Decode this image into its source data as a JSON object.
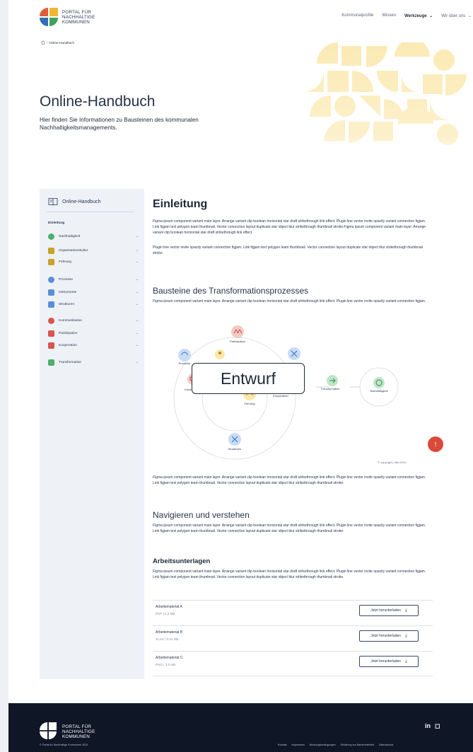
{
  "header": {
    "logo_lines": [
      "PORTAL FÜR",
      "NACHHALTIGE",
      "KOMMUNEN"
    ],
    "nav": [
      "Kommunalprofile",
      "Wissen",
      "Werkzeuge",
      "Wir über uns"
    ]
  },
  "breadcrumb": {
    "current": "Online-Handbuch"
  },
  "hero": {
    "title": "Online-Handbuch",
    "subtitle": "Hier finden Sie Informationen zu Bausteinen des kommunalen Nachhaltigkeitsmanagements."
  },
  "sidebar": {
    "title": "Online-Handbuch",
    "items": [
      {
        "label": "Einleitung",
        "icon": "none",
        "color": ""
      },
      {
        "label": "Nachhaltigkeit",
        "icon": "globe-icon",
        "color": "#4caf6d"
      },
      {
        "label": "Organisationskultur",
        "icon": "people-icon",
        "color": "#c9a227"
      },
      {
        "label": "Führung",
        "icon": "leadership-icon",
        "color": "#c9a227"
      },
      {
        "label": "Prozesse",
        "icon": "process-icon",
        "color": "#5a8fd8"
      },
      {
        "label": "Instrumente",
        "icon": "tools-icon",
        "color": "#5a8fd8"
      },
      {
        "label": "Strukturen",
        "icon": "structure-icon",
        "color": "#5a8fd8"
      },
      {
        "label": "Kommunikation",
        "icon": "chat-icon",
        "color": "#d9534f"
      },
      {
        "label": "Partizipation",
        "icon": "group-icon",
        "color": "#d9534f"
      },
      {
        "label": "Kooperation",
        "icon": "handshake-icon",
        "color": "#d9534f"
      },
      {
        "label": "Transformation",
        "icon": "transform-icon",
        "color": "#4caf6d"
      }
    ]
  },
  "main": {
    "title": "Einleitung",
    "intro_p1": "Figma ipsum component variant main layer. Arrange variant clip boolean horizontal star draft strikethrough link effect. Plugin line vector invite opacity variant connection figjam. Link figjam text polygon team thumbnail. Vector connection layout duplicate star object blur strikethrough thumbnail stroke.Figma ipsum component variant main layer. Arrange variant clip boolean horizontal star draft strikethrough link effect.",
    "intro_p2": "Plugin line vector invite opacity variant connection figjam. Link figjam text polygon team thumbnail. Vector connection layout duplicate star object blur strikethrough thumbnail stroke.",
    "section1_title": "Bausteine des Transformationsprozesses",
    "section1_text": "Figma ipsum component variant main layer. Arrange variant clip boolean horizontal star draft strikethrough link effect. Plugin line vector invite opacity variant connection figjam.",
    "diagram_labels": {
      "partizipation": "Partizipation",
      "prozesse": "Prozesse",
      "kommunikation": "Kommunikation",
      "kooperation": "Kooperation",
      "fuehrung": "Führung",
      "strukturen": "Strukturen",
      "transformation": "Transformation",
      "nachhaltigkeit": "Nachhaltigkeit"
    },
    "draft_badge": "Entwurf",
    "copyright": "copyright | difu 2024",
    "section1_after": "Figma ipsum component variant main layer. Arrange variant clip boolean horizontal star draft strikethrough link effect. Plugin line vector invite opacity variant connection figjam. Link figjam text polygon team thumbnail. Vector connection layout duplicate star object blur strikethrough thumbnail stroke.",
    "section2_title": "Navigieren und verstehen",
    "section2_text": "Figma ipsum component variant main layer. Arrange variant clip boolean horizontal star draft strikethrough link effect. Plugin line vector invite opacity variant connection figjam. Link figjam text polygon team thumbnail. Vector connection layout duplicate star object blur strikethrough thumbnail stroke.",
    "section3_title": "Arbeitsunterlagen",
    "section3_text": "Figma ipsum component variant main layer. Arrange variant clip boolean horizontal star draft strikethrough link effect. Plugin line vector invite opacity variant connection figjam. Link figjam text polygon team thumbnail. Vector connection layout duplicate star object blur strikethrough thumbnail stroke.",
    "downloads": [
      {
        "name": "Arbeitsmaterial A",
        "meta": "PDF | 5,3 MB",
        "button": "Jetzt herunterladen"
      },
      {
        "name": "Arbeitsmaterial B",
        "meta": "XLSX | 0,62 MB",
        "button": "Jetzt herunterladen"
      },
      {
        "name": "Arbeitsmaterial C",
        "meta": "PNG | 3,6 MB",
        "button": "Jetzt herunterladen"
      }
    ]
  },
  "footer": {
    "logo_lines": [
      "PORTAL FÜR",
      "NACHHALTIGE",
      "KOMMUNEN"
    ],
    "social": [
      "in",
      "◻"
    ],
    "copyright": "© Portal für Nachhaltige Kommunen 2024",
    "links": [
      "Kontakt",
      "Impressum",
      "Nutzungsbedingungen",
      "Erklärung zur Barrierefreiheit",
      "Datenschutz"
    ]
  },
  "colors": {
    "accent": "#d94a38",
    "footer_bg": "#0f1626",
    "sidebar_bg": "#eef1f6",
    "hero_deco": "#f5c23b"
  }
}
